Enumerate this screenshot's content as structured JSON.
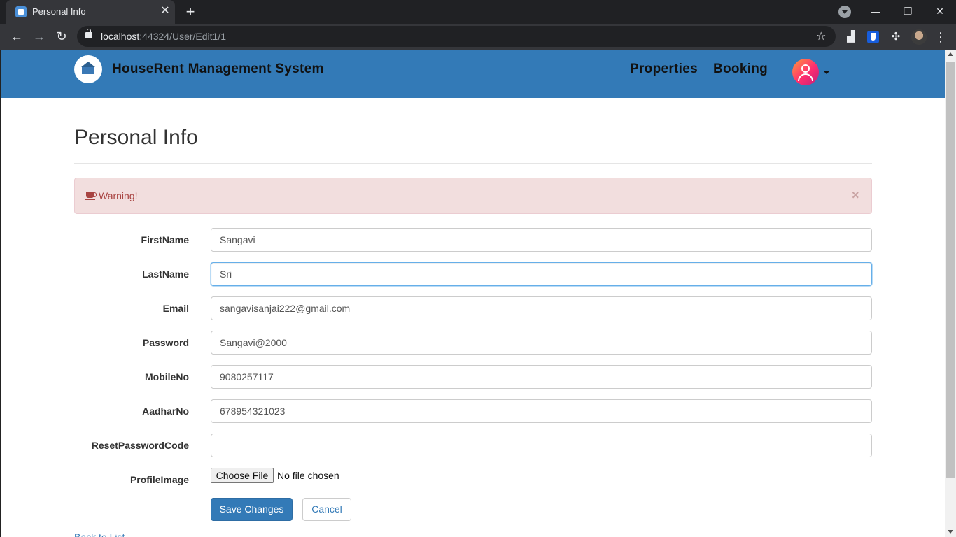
{
  "browser": {
    "tab_title": "Personal Info",
    "url_host": "localhost",
    "url_path": ":44324/User/Edit1/1"
  },
  "app": {
    "brand": "HouseRent Management System",
    "nav": {
      "properties": "Properties",
      "booking": "Booking"
    }
  },
  "page": {
    "title": "Personal Info",
    "alert": "Warning!"
  },
  "form": {
    "fields": [
      {
        "label": "FirstName",
        "value": "Sangavi"
      },
      {
        "label": "LastName",
        "value": "Sri"
      },
      {
        "label": "Email",
        "value": "sangavisanjai222@gmail.com"
      },
      {
        "label": "Password",
        "value": "Sangavi@2000"
      },
      {
        "label": "MobileNo",
        "value": "9080257117"
      },
      {
        "label": "AadharNo",
        "value": "678954321023"
      },
      {
        "label": "ResetPasswordCode",
        "value": ""
      }
    ],
    "profile_image": {
      "label": "ProfileImage",
      "button": "Choose File",
      "status": "No file chosen"
    },
    "save": "Save Changes",
    "cancel": "Cancel",
    "back": "Back to List"
  },
  "colors": {
    "navbar": "#337ab7",
    "primary": "#337ab7",
    "alert_bg": "#f2dede",
    "alert_text": "#a94442"
  },
  "icons": [
    "close-icon",
    "plus-icon",
    "back-icon",
    "forward-icon",
    "reload-icon",
    "lock-icon",
    "star-icon",
    "extensions-icon",
    "menu-icon",
    "user-icon",
    "coffee-icon"
  ]
}
